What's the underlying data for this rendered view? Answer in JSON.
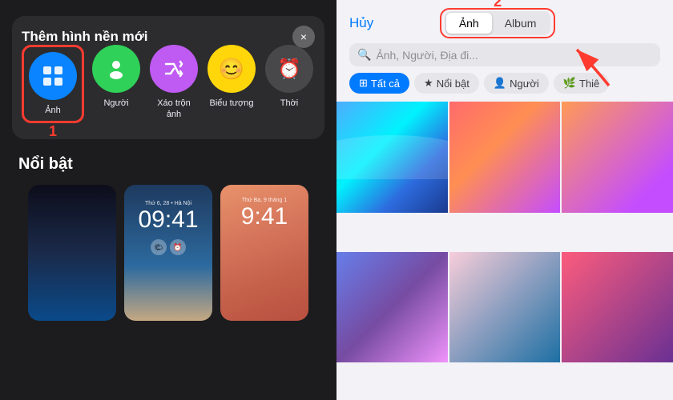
{
  "left": {
    "modal": {
      "title": "Thêm hình nền mới",
      "close_label": "×",
      "options": [
        {
          "id": "anh",
          "label": "Ảnh",
          "icon": "🖼",
          "color": "blue",
          "highlighted": true
        },
        {
          "id": "nguoi",
          "label": "Người",
          "icon": "👤",
          "color": "green"
        },
        {
          "id": "xao-tron",
          "label": "Xáo trộn\nảnh",
          "icon": "🔀",
          "color": "purple"
        },
        {
          "id": "bieu-tuong",
          "label": "Biểu tượng",
          "icon": "😊",
          "color": "yellow"
        },
        {
          "id": "thoi",
          "label": "Thời",
          "icon": "⏰",
          "color": "gray"
        }
      ],
      "number_1": "1"
    },
    "noi_bat": {
      "title": "Nổi bật"
    }
  },
  "right": {
    "huy_label": "Hủy",
    "number_2": "2",
    "tabs": [
      {
        "id": "anh",
        "label": "Ảnh",
        "active": true
      },
      {
        "id": "album",
        "label": "Album",
        "active": false
      }
    ],
    "search_placeholder": "🔍 Ảnh, Người, Địa đi...",
    "filters": [
      {
        "id": "tat-ca",
        "label": "Tất cả",
        "icon": "⊞",
        "active": true
      },
      {
        "id": "noi-bat",
        "label": "Nổi bật",
        "icon": "★",
        "active": false
      },
      {
        "id": "nguoi",
        "label": "Người",
        "icon": "👤",
        "active": false
      },
      {
        "id": "thie",
        "label": "Thiê",
        "icon": "🌿",
        "active": false
      }
    ]
  }
}
